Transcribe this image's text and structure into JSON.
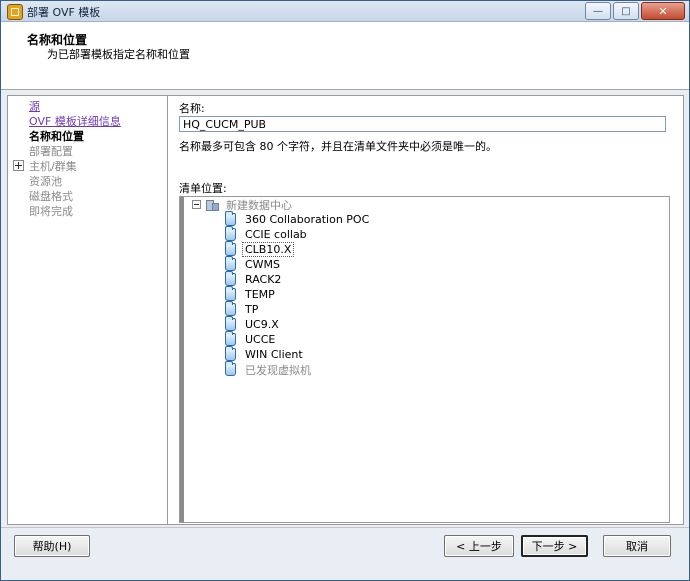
{
  "window": {
    "title": "部署 OVF 模板",
    "minimize": "—",
    "maximize": "□",
    "close": "✕"
  },
  "header": {
    "title": "名称和位置",
    "subtitle": "为已部署模板指定名称和位置"
  },
  "steps": [
    {
      "label": "源",
      "state": "link"
    },
    {
      "label": "OVF 模板详细信息",
      "state": "link"
    },
    {
      "label": "名称和位置",
      "state": "current"
    },
    {
      "label": "部署配置",
      "state": "pending"
    },
    {
      "label": "主机/群集",
      "state": "pending"
    },
    {
      "label": "资源池",
      "state": "pending"
    },
    {
      "label": "磁盘格式",
      "state": "pending"
    },
    {
      "label": "即将完成",
      "state": "pending"
    }
  ],
  "form": {
    "name_label": "名称:",
    "name_value": "HQ_CUCM_PUB",
    "name_hint": "名称最多可包含 80 个字符，并且在清单文件夹中必须是唯一的。",
    "inventory_label": "清单位置:"
  },
  "tree": {
    "root": "新建数据中心",
    "folders": [
      "360 Collaboration POC",
      "CCIE collab",
      "CLB10.X",
      "CWMS",
      "RACK2",
      "TEMP",
      "TP",
      "UC9.X",
      "UCCE",
      "WIN Client",
      "已发现虚拟机"
    ],
    "selected": "CLB10.X"
  },
  "buttons": {
    "help": "帮助(H)",
    "back": "< 上一步",
    "next": "下一步 >",
    "cancel": "取消"
  },
  "icons": {
    "app": "vsphere-app-icon",
    "folder": "folder-icon",
    "datacenter": "datacenter-icon"
  }
}
